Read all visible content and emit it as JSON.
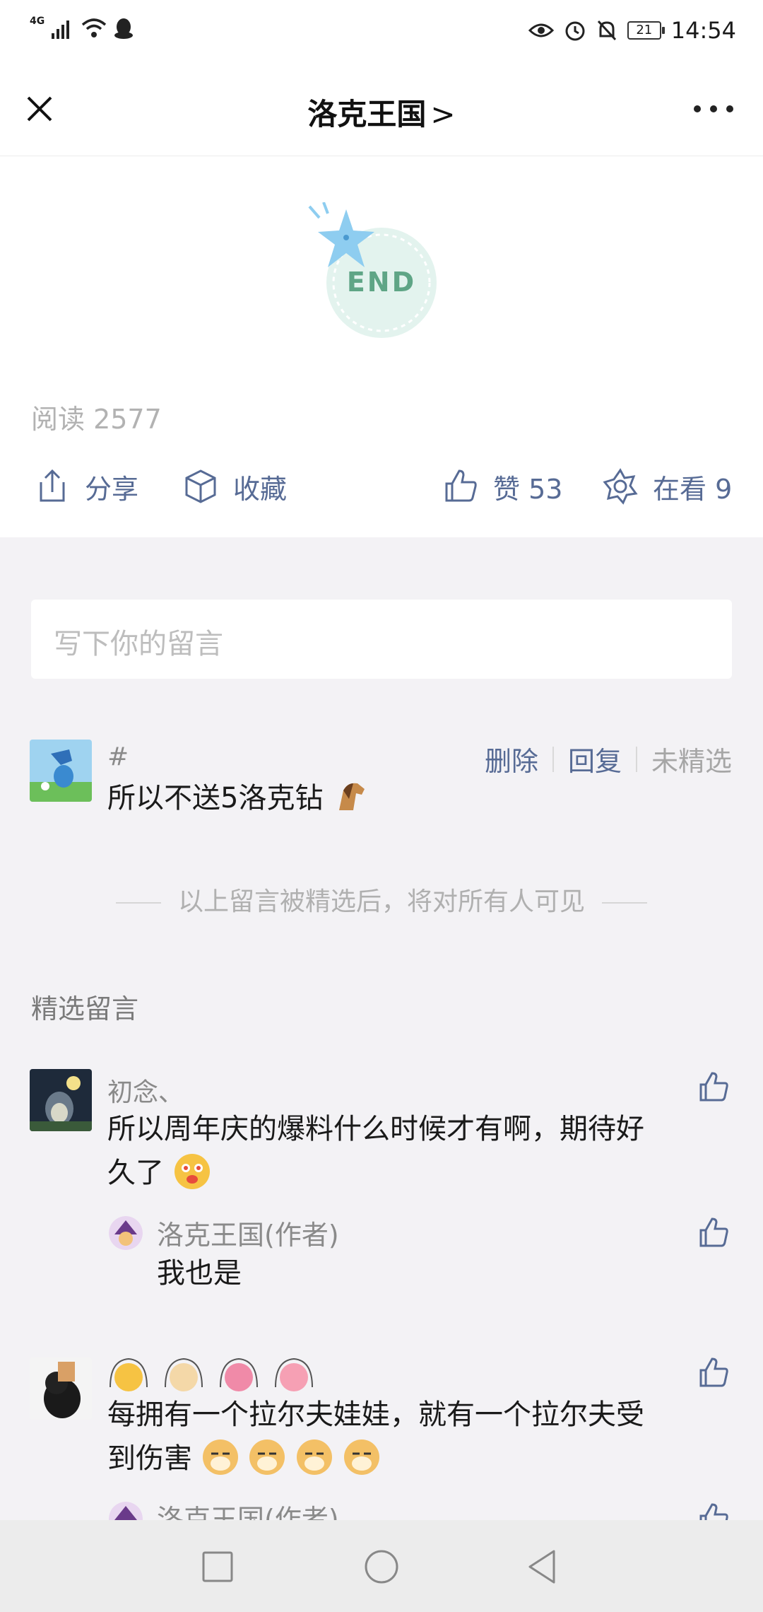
{
  "status_bar": {
    "network": "4G",
    "battery": "21",
    "time": "14:54"
  },
  "navbar": {
    "title": "洛克王国",
    "chevron": ">"
  },
  "article": {
    "end_label": "END",
    "read_count": "阅读 2577"
  },
  "actions": {
    "share": "分享",
    "favorite": "收藏",
    "like": "赞 53",
    "wow": "在看 9"
  },
  "comment_input": {
    "placeholder": "写下你的留言"
  },
  "my_comment": {
    "nickname": "#",
    "text": "所以不送5洛克钻",
    "ops": [
      "删除",
      "回复",
      "未精选"
    ]
  },
  "notice": "以上留言被精选后，将对所有人可见",
  "featured": {
    "title": "精选留言",
    "comments": [
      {
        "nickname": "初念、",
        "text_line1": "所以周年庆的爆料什么时候才有啊，期待好",
        "text_line2": "久了",
        "reply": {
          "author": "洛克王国(作者)",
          "text": "我也是"
        }
      },
      {
        "nickname": "",
        "text_line1": "每拥有一个拉尔夫娃娃，就有一个拉尔夫受",
        "text_line2": "到伤害",
        "reply": {
          "author": "洛克王国(作者)",
          "text": ""
        }
      }
    ]
  },
  "colors": {
    "link_blue": "#576b95",
    "comment_bg": "#f3f2f5",
    "end_green": "#5fa586"
  }
}
